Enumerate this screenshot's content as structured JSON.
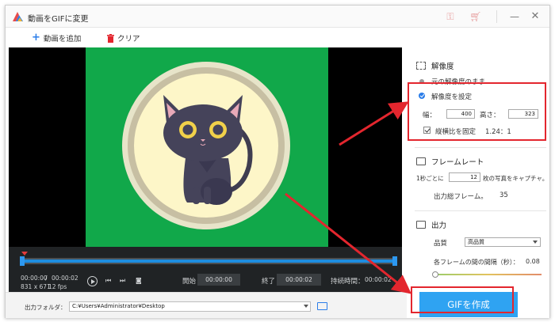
{
  "window": {
    "title": "動画をGIFに変更"
  },
  "toolbar": {
    "add_video": "動画を追加",
    "clear": "クリア"
  },
  "player": {
    "current_time": "00:00:00",
    "total_time": "00:00:02",
    "resolution": "831 x 671",
    "fps": "12 fps",
    "start_label": "開始",
    "start_value": "00:00:00",
    "end_label": "終了",
    "end_value": "00:00:02",
    "duration_label": "持続時間：",
    "duration_value": "00:00:02"
  },
  "output_folder": {
    "label": "出力フォルダ：",
    "path": "C:¥Users¥Administrator¥Desktop"
  },
  "resolution": {
    "heading": "解像度",
    "keep_original": "元の解像度のまま",
    "set_resolution": "解像度を設定",
    "width_label": "幅：",
    "width_value": "400",
    "height_label": "高さ：",
    "height_value": "323",
    "aspect_label": "縦横比を固定",
    "aspect_value": "1.24：1"
  },
  "frame_rate": {
    "heading": "フレームレート",
    "per_second_prefix": "1秒ごとに",
    "per_second_value": "12",
    "per_second_suffix": "枚の写真をキャプチャ。",
    "total_frames_label": "出力総フレーム。",
    "total_frames_value": "35"
  },
  "output": {
    "heading": "出力",
    "quality_label": "品質",
    "quality_value": "高品質",
    "interval_label": "各フレームの間の間隔（秒）：",
    "interval_value": "0.08"
  },
  "make_gif_button": "GIFを作成",
  "colors": {
    "accent": "#2b7de9",
    "gif_button": "#2fa3f2",
    "highlight": "#e3262e",
    "video_bg": "#11a84a"
  }
}
